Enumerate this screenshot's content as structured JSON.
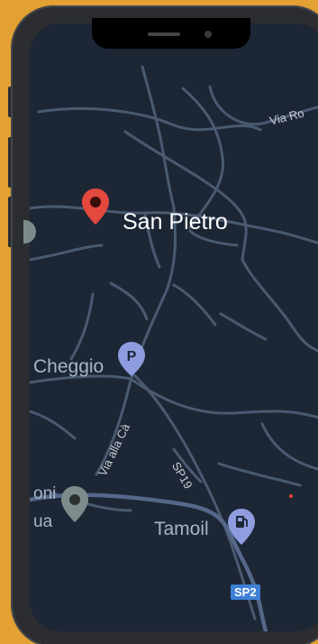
{
  "map": {
    "main_place": "San Pietro",
    "places": {
      "cheggio": "Cheggio",
      "fuel_station": "Tamoil",
      "poi_left_line1": "oni",
      "poi_left_line2": "ua"
    },
    "roads": {
      "via_ca": "Via alla Cà",
      "sp19": "SP19",
      "via_ro": "Via Ro",
      "sp2": "SP2"
    },
    "icons": {
      "primary_pin": "location-pin-icon",
      "parking": "parking-icon",
      "fuel": "fuel-pump-icon",
      "generic_pin": "map-pin-icon"
    },
    "parking_glyph": "P"
  },
  "colors": {
    "background": "#e3a033",
    "map_background": "#1d2635",
    "road": "#4a5a70",
    "primary_pin": "#e5483d",
    "poi_pin": "#8f9de0",
    "generic_pin": "#7d8c8a",
    "road_shield": "#3f7fd6"
  }
}
